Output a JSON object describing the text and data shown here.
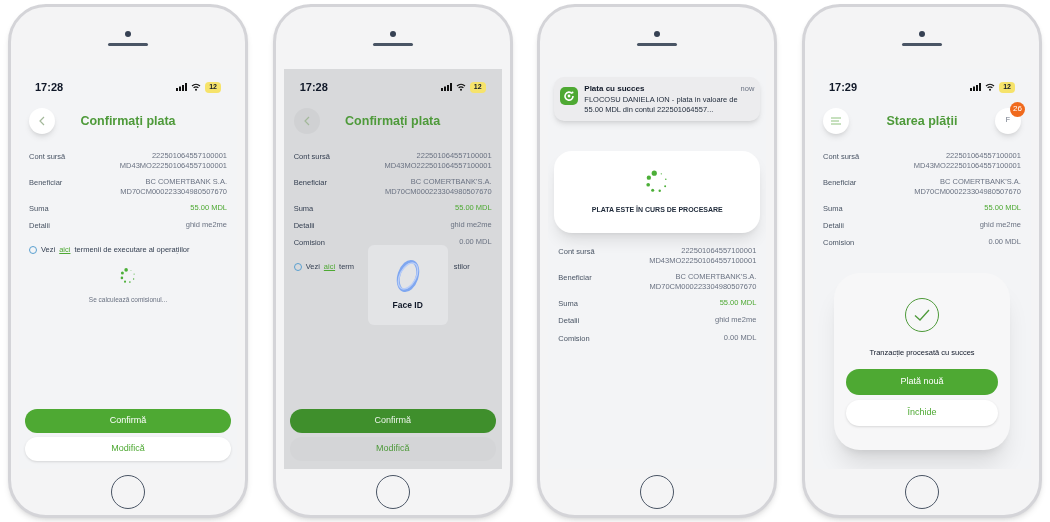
{
  "phones": [
    {
      "dimmed": false,
      "status_bar": {
        "time": "17:28",
        "battery": "12"
      },
      "header": {
        "kind": "back",
        "title": "Confirmați plata"
      },
      "rows": [
        {
          "label": "Cont sursă",
          "lines": [
            "222501064557100001",
            "MD43MO222501064557100001"
          ],
          "accent": false
        },
        {
          "label": "Beneficiar",
          "lines": [
            "BC COMERTBANK S.A.",
            "MD70CM000223304980507670"
          ],
          "accent": false
        },
        {
          "label": "Suma",
          "lines": [
            "55.00 MDL"
          ],
          "accent": true
        },
        {
          "label": "Detalii",
          "lines": [
            "ghid me2me"
          ],
          "accent": false
        }
      ],
      "info": {
        "parts": [
          {
            "text": "Vezi",
            "link": false
          },
          {
            "text": "aici",
            "link": true
          },
          {
            "text": "termenii de executare al operațiilor",
            "link": false
          }
        ]
      },
      "loading": {
        "text": "Se calculează comisionul..."
      },
      "buttons": [
        {
          "label": "Confirmă",
          "primary": true
        },
        {
          "label": "Modifică",
          "primary": false
        }
      ]
    },
    {
      "dimmed": true,
      "status_bar": {
        "time": "17:28",
        "battery": "12"
      },
      "header": {
        "kind": "back",
        "title": "Confirmați plata"
      },
      "rows": [
        {
          "label": "Cont sursă",
          "lines": [
            "222501064557100001",
            "MD43MO222501064557100001"
          ],
          "accent": false
        },
        {
          "label": "Beneficiar",
          "lines": [
            "BC COMERTBANK'S.A.",
            "MD70CM000223304980507670"
          ],
          "accent": false
        },
        {
          "label": "Suma",
          "lines": [
            "55.00 MDL"
          ],
          "accent": true
        },
        {
          "label": "Detalii",
          "lines": [
            "ghid me2me"
          ],
          "accent": false
        },
        {
          "label": "Comision",
          "lines": [
            "0.00 MDL"
          ],
          "accent": false
        }
      ],
      "info": {
        "parts": [
          {
            "text": "Vezi",
            "link": false
          },
          {
            "text": "aici",
            "link": true
          },
          {
            "text": "term",
            "link": false
          }
        ],
        "tail": "stilor"
      },
      "face_id": {
        "label": "Face ID"
      },
      "buttons": [
        {
          "label": "Confirmă",
          "primary": true
        },
        {
          "label": "Modifică",
          "primary": false
        }
      ]
    },
    {
      "dimmed": false,
      "notification": {
        "title": "Plata cu succes",
        "time": "now",
        "body": "FLOCOSU DANIELA ION - plata in valoare de 55.00 MDL din contul 222501064557..."
      },
      "processing": {
        "text": "PLATA ESTE ÎN CURS DE PROCESARE"
      },
      "rows": [
        {
          "label": "Cont sursă",
          "lines": [
            "222501064557100001",
            "MD43MO222501064557100001"
          ],
          "accent": false
        },
        {
          "label": "Beneficiar",
          "lines": [
            "BC COMERTBANK'S.A.",
            "MD70CM000223304980507670"
          ],
          "accent": false
        },
        {
          "label": "Suma",
          "lines": [
            "55.00 MDL"
          ],
          "accent": true
        },
        {
          "label": "Detalii",
          "lines": [
            "ghid me2me"
          ],
          "accent": false
        },
        {
          "label": "Comision",
          "lines": [
            "0.00 MDL"
          ],
          "accent": false
        }
      ]
    },
    {
      "dimmed": false,
      "status_bar": {
        "time": "17:29",
        "battery": "12"
      },
      "header": {
        "kind": "menu",
        "title": "Starea plății",
        "avatar": {
          "initial": "F",
          "badge": "26"
        }
      },
      "rows": [
        {
          "label": "Cont sursă",
          "lines": [
            "222501064557100001",
            "MD43MO222501064557100001"
          ],
          "accent": false
        },
        {
          "label": "Beneficiar",
          "lines": [
            "BC COMERTBANK'S.A.",
            "MD70CM000223304980507670"
          ],
          "accent": false
        },
        {
          "label": "Suma",
          "lines": [
            "55.00 MDL"
          ],
          "accent": true
        },
        {
          "label": "Detalii",
          "lines": [
            "ghid me2me"
          ],
          "accent": false
        },
        {
          "label": "Comision",
          "lines": [
            "0.00 MDL"
          ],
          "accent": false
        }
      ],
      "success": {
        "text": "Tranzacție procesată cu succes",
        "buttons": [
          {
            "label": "Plată nouă",
            "primary": true
          },
          {
            "label": "Închide",
            "primary": false
          }
        ]
      }
    }
  ]
}
